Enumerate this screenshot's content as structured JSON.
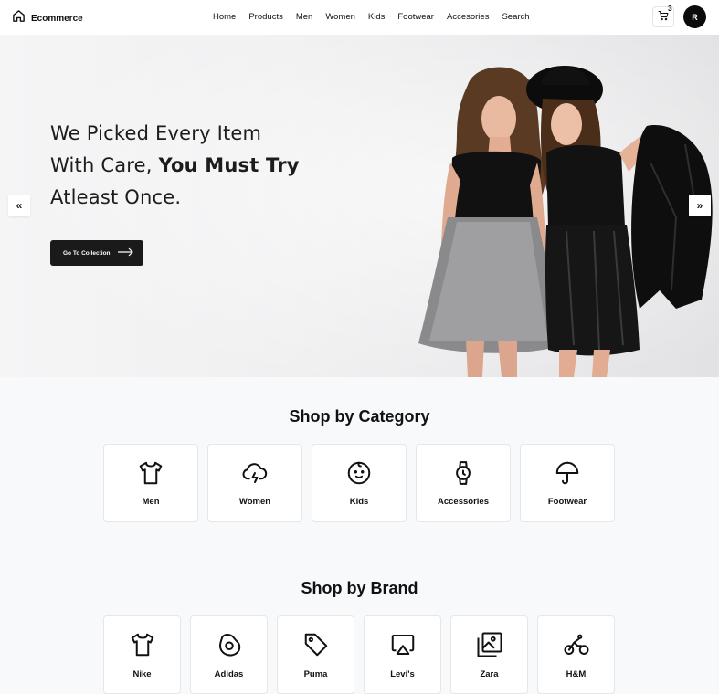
{
  "header": {
    "brand": "Ecommerce",
    "nav": [
      "Home",
      "Products",
      "Men",
      "Women",
      "Kids",
      "Footwear",
      "Accesories",
      "Search"
    ],
    "cart_count": "3",
    "avatar_initial": "R"
  },
  "hero": {
    "line1": "We Picked Every Item",
    "line2_plain": "With Care, ",
    "line2_bold": "You Must Try",
    "line3": "Atleast Once.",
    "cta_label": "Go To Collection",
    "prev_label": "«",
    "next_label": "»"
  },
  "categories": {
    "title": "Shop by Category",
    "items": [
      {
        "label": "Men",
        "icon": "tshirt-icon"
      },
      {
        "label": "Women",
        "icon": "cloud-lightning-icon"
      },
      {
        "label": "Kids",
        "icon": "baby-face-icon"
      },
      {
        "label": "Accessories",
        "icon": "watch-icon"
      },
      {
        "label": "Footwear",
        "icon": "umbrella-icon"
      }
    ]
  },
  "brands": {
    "title": "Shop by Brand",
    "items": [
      {
        "label": "Nike",
        "icon": "tshirt-icon"
      },
      {
        "label": "Adidas",
        "icon": "egg-icon"
      },
      {
        "label": "Puma",
        "icon": "tag-icon"
      },
      {
        "label": "Levi's",
        "icon": "airplay-icon"
      },
      {
        "label": "Zara",
        "icon": "gallery-icon"
      },
      {
        "label": "H&M",
        "icon": "bicycle-icon"
      }
    ]
  }
}
